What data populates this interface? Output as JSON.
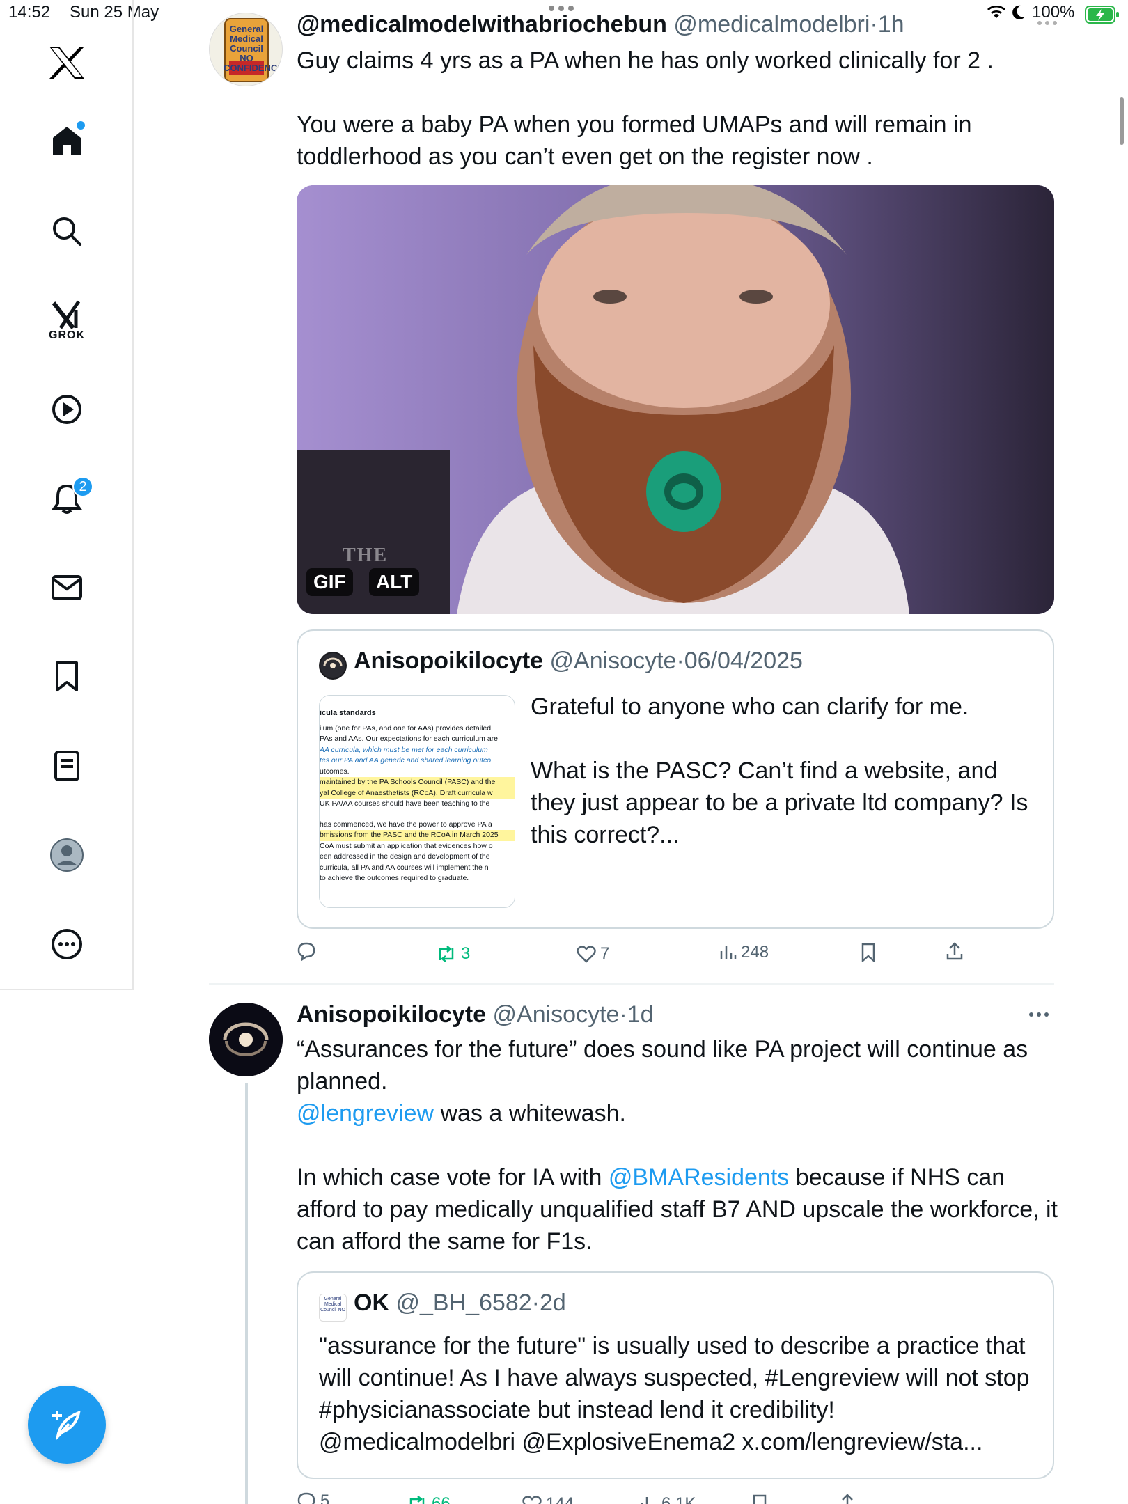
{
  "status_bar": {
    "time": "14:52",
    "date": "Sun 25 May",
    "battery": "100%"
  },
  "nav": {
    "items": [
      {
        "icon": "x-logo-icon"
      },
      {
        "icon": "home-icon"
      },
      {
        "icon": "search-icon"
      },
      {
        "icon": "grok-icon",
        "label": "GROK"
      },
      {
        "icon": "video-icon"
      },
      {
        "icon": "bell-icon",
        "badge": "2"
      },
      {
        "icon": "mail-icon"
      },
      {
        "icon": "bookmark-icon"
      },
      {
        "icon": "lists-icon"
      },
      {
        "icon": "profile-icon"
      },
      {
        "icon": "more-icon"
      }
    ],
    "compose_icon": "compose-icon"
  },
  "tweet1": {
    "name": "@medicalmodelwithabriochebun",
    "handle": "@medicalmodelbri",
    "time": "1h",
    "text_line1": "Guy claims 4 yrs as a PA when he has only worked clinically for 2 .",
    "text_line2": "You were a baby PA when you formed UMAPs and will remain in toddlerhood as you can’t even get on the register now .",
    "avatar_text": "General Medical Council NO CONFIDENCE",
    "media": {
      "gif_label": "GIF",
      "alt_label": "ALT",
      "watermark": "THE"
    },
    "quote": {
      "name": "Anisopoikilocyte",
      "handle": "@Anisocyte",
      "date": "06/04/2025",
      "text1": "Grateful to anyone who can clarify for me.",
      "text2": "What is the PASC? Can’t find a website, and they just appear to be a private ltd company? Is this correct?...",
      "doc_lines": [
        "icula standards",
        "ilum (one for PAs, and one for AAs) provides detailed",
        "PAs and AAs. Our expectations for each curriculum are",
        "AA curricula, which must be met for each curriculum",
        "tes our PA and AA generic and shared learning outco",
        "utcomes.",
        "maintained by the PA Schools Council (PASC) and the",
        "yal College of Anaesthetists (RCoA). Draft curricula w",
        "UK PA/AA courses should have been teaching to the",
        "has commenced, we have the power to approve PA a",
        "bmissions from the PASC and the RCoA in March 2025",
        "CoA must submit an application that evidences how o",
        "een addressed in the design and development of the",
        "curricula, all PA and AA courses will implement the n",
        "to achieve the outcomes required to graduate."
      ]
    },
    "actions": {
      "replies": "",
      "reposts": "3",
      "likes": "7",
      "views": "248"
    }
  },
  "tweet2": {
    "name": "Anisopoikilocyte",
    "handle": "@Anisocyte",
    "time": "1d",
    "line1": "“Assurances for the future” does sound like PA project will continue as planned.",
    "mention1": "@lengreview",
    "line2_rest": " was a whitewash.",
    "line3_start": "In which case vote for IA with ",
    "mention2": "@BMAResidents",
    "line3_rest": " because if NHS can afford to pay medically unqualified staff B7 AND upscale the workforce, it can afford the same for F1s.",
    "quote": {
      "name": "OK",
      "handle": "@_BH_6582",
      "time": "2d",
      "avatar_text": "General Medical Council NO",
      "text": "\"assurance for the future\" is usually used to describe a practice that will continue! As I have always suspected, #Lengreview will not stop #physicianassociate but instead lend it credibility! @medicalmodelbri @ExplosiveEnema2 x.com/lengreview/sta..."
    },
    "actions": {
      "replies": "5",
      "reposts": "66",
      "likes": "144",
      "views": "6.1K"
    }
  },
  "colors": {
    "accent": "#1d9bf0",
    "repost_green": "#00ba7c",
    "secondary_text": "#536471"
  }
}
